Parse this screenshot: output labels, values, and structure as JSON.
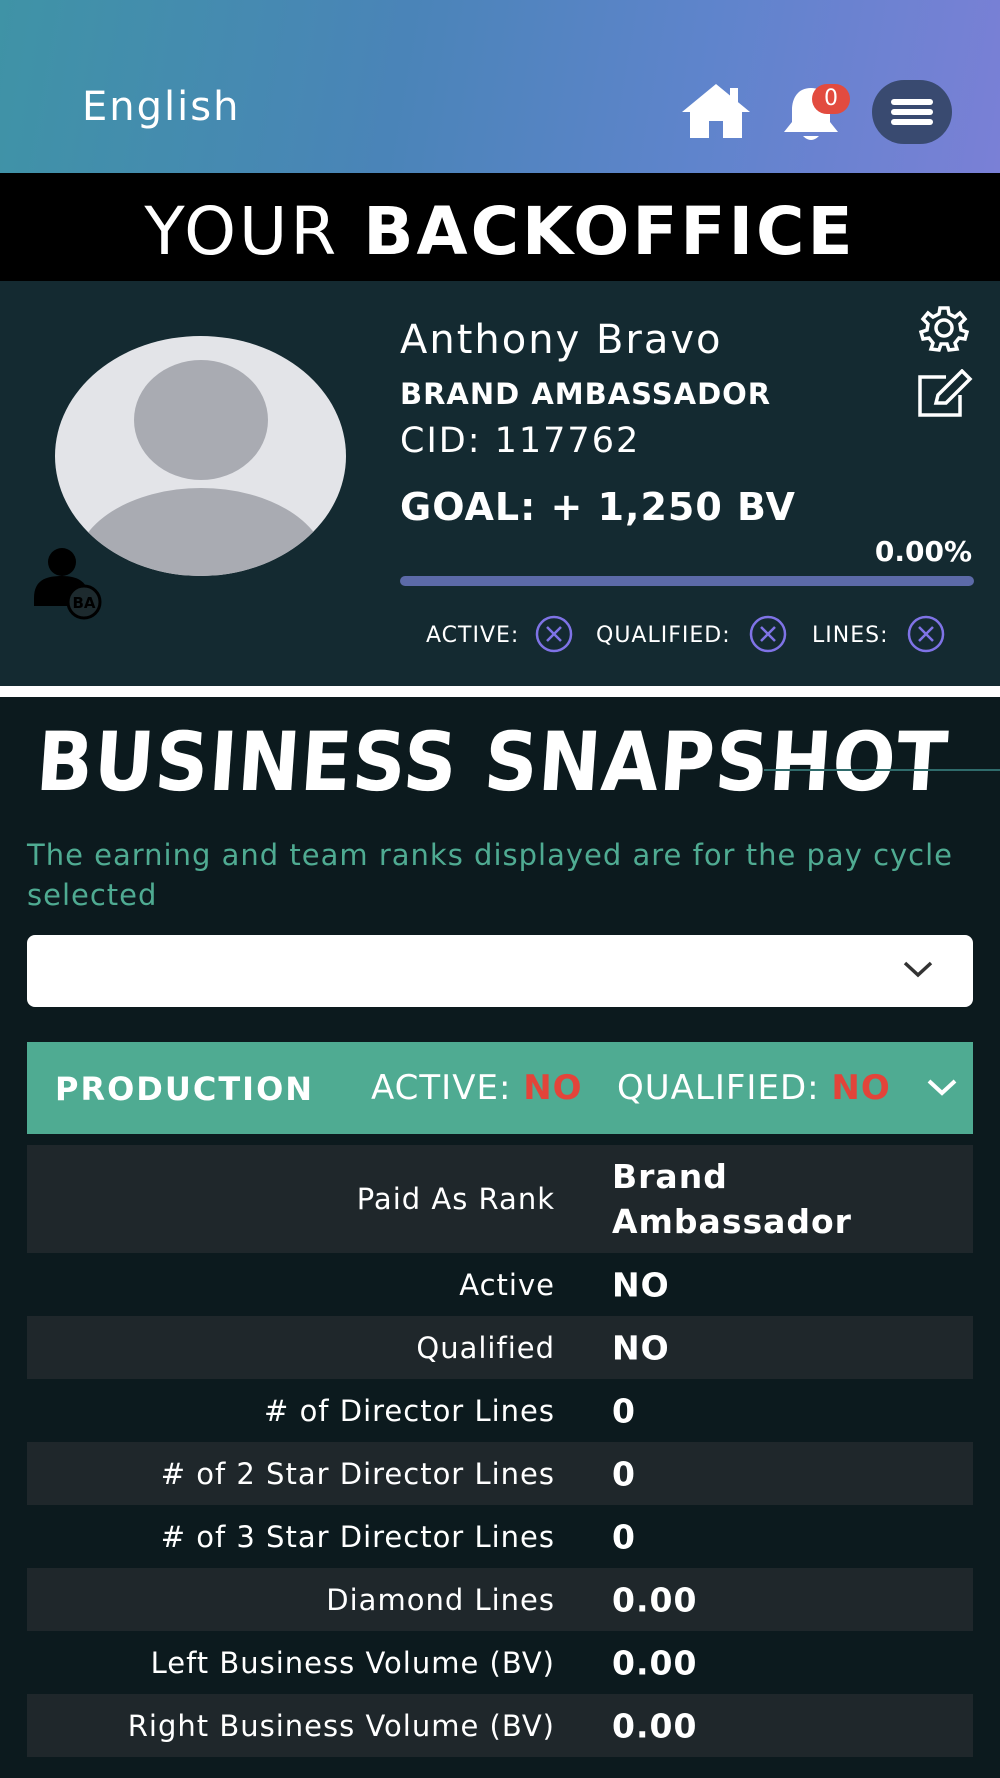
{
  "header": {
    "language": "English",
    "notifications_count": "0",
    "brand_light": "YOUR ",
    "brand_bold": "BACKOFFICE"
  },
  "profile": {
    "name": "Anthony Bravo",
    "rank": "BRAND AMBASSADOR",
    "cid": "CID: 117762",
    "goal": "GOAL: + 1,250 BV",
    "progress_percent": "0.00%",
    "progress_value": 0,
    "badge_text": "BA",
    "status": {
      "active_label": "ACTIVE:",
      "qualified_label": "QUALIFIED:",
      "lines_label": "LINES:"
    }
  },
  "snapshot": {
    "title": "BUSINESS SNAPSHOT",
    "note": "The earning and team ranks displayed are for the pay cycle selected",
    "pay_cycle_selected": "",
    "production": {
      "label": "PRODUCTION",
      "active_label": "ACTIVE:",
      "active_value": "NO",
      "qualified_label": "QUALIFIED:",
      "qualified_value": "NO"
    },
    "rows": [
      {
        "key": "Paid As Rank",
        "value": "Brand Ambassador"
      },
      {
        "key": "Active",
        "value": "NO"
      },
      {
        "key": "Qualified",
        "value": "NO"
      },
      {
        "key": "# of Director Lines",
        "value": "0"
      },
      {
        "key": "# of 2 Star Director Lines",
        "value": "0"
      },
      {
        "key": "# of 3 Star Director Lines",
        "value": "0"
      },
      {
        "key": "Diamond Lines",
        "value": "0.00"
      },
      {
        "key": "Left Business Volume (BV)",
        "value": "0.00"
      },
      {
        "key": "Right Business Volume (BV)",
        "value": "0.00"
      }
    ]
  },
  "colors": {
    "accent_teal": "#4fab92",
    "negative_red": "#e2443a",
    "progress": "#5c6aa8"
  },
  "icons": {
    "home": "home-icon",
    "bell": "bell-icon",
    "menu": "hamburger-icon",
    "settings": "gear-icon",
    "edit": "edit-icon",
    "status": "x-circle-icon"
  }
}
